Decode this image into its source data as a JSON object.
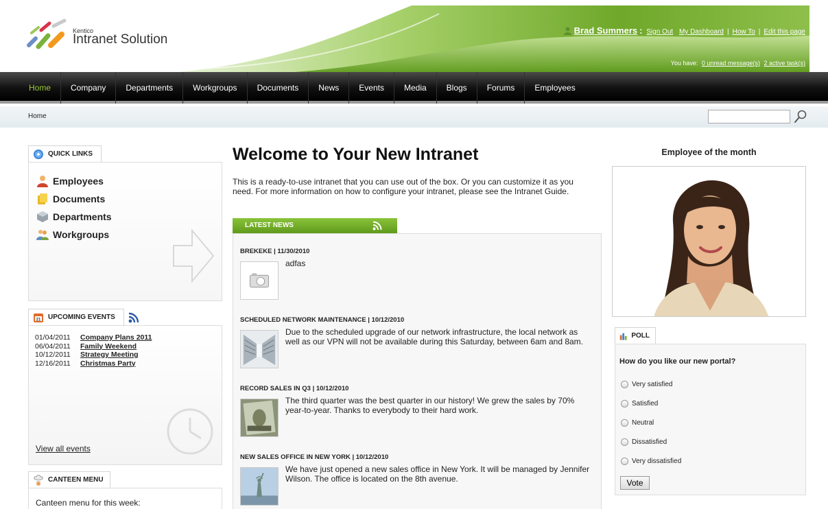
{
  "header": {
    "brand_small": "Kentico",
    "brand_big": "Intranet Solution",
    "user_name": "Brad Summers",
    "user_colon": ":",
    "links": [
      "Sign Out",
      "My Dashboard",
      "How To",
      "Edit this page"
    ],
    "link_separator": "|",
    "you_have": "You have:",
    "unread_messages": "0 unread message(s)",
    "active_tasks": "2 active task(s)"
  },
  "nav": {
    "items": [
      "Home",
      "Company",
      "Departments",
      "Workgroups",
      "Documents",
      "News",
      "Events",
      "Media",
      "Blogs",
      "Forums",
      "Employees"
    ],
    "active": "Home"
  },
  "breadcrumb": {
    "current": "Home"
  },
  "search": {
    "value": "",
    "icon": "magnifier-icon"
  },
  "quick_links": {
    "title": "QUICK LINKS",
    "items": [
      "Employees",
      "Documents",
      "Departments",
      "Workgroups"
    ]
  },
  "events": {
    "title": "UPCOMING EVENTS",
    "items": [
      {
        "date": "01/04/2011",
        "name": "Company Plans 2011"
      },
      {
        "date": "06/04/2011",
        "name": "Family Weekend"
      },
      {
        "date": "10/12/2011",
        "name": "Strategy Meeting"
      },
      {
        "date": "12/16/2011",
        "name": "Christmas Party"
      }
    ],
    "view_all": "View all events"
  },
  "canteen": {
    "title": "CANTEEN MENU",
    "text": "Canteen menu for this week:"
  },
  "welcome": {
    "title": "Welcome to Your New Intranet",
    "text": "This is a ready-to-use intranet that you can use out of the box. Or you can customize it as you need. For more information on how to configure your intranet, please see the Intranet Guide."
  },
  "news": {
    "tab_title": "LATEST NEWS",
    "items": [
      {
        "title": "BREKEKE | 11/30/2010",
        "body": "adfas"
      },
      {
        "title": "SCHEDULED NETWORK MAINTENANCE | 10/12/2010",
        "body": "Due to the scheduled upgrade of our network infrastructure, the local network as well as our VPN will not be available during this Saturday, between 6am and 8am."
      },
      {
        "title": "RECORD SALES IN Q3 | 10/12/2010",
        "body": "The third quarter was the best quarter in our history! We grew the sales by 70% year-to-year. Thanks to everybody to their hard work."
      },
      {
        "title": "NEW SALES OFFICE IN NEW YORK | 10/12/2010",
        "body": "We have just opened a new sales office in New York. It will be managed by Jennifer Wilson. The office is located on the 8th avenue."
      }
    ]
  },
  "employee_of_month": {
    "title": "Employee of the month"
  },
  "poll": {
    "title": "POLL",
    "question": "How do you like our new portal?",
    "options": [
      "Very satisfied",
      "Satisfied",
      "Neutral",
      "Dissatisfied",
      "Very dissatisfied"
    ],
    "vote_label": "Vote"
  },
  "colors": {
    "accent_green": "#78b22c",
    "nav_bg": "#111111",
    "active_nav": "#9ccc3a"
  }
}
